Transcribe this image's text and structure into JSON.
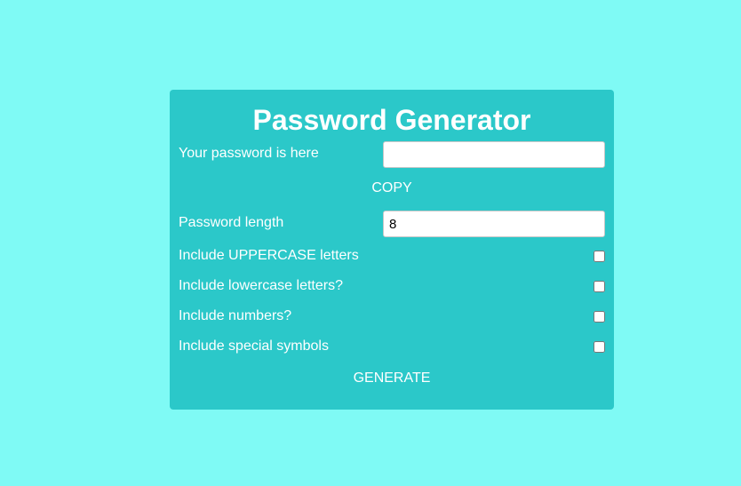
{
  "app": {
    "title": "Password Generator"
  },
  "password": {
    "label": "Your password is here",
    "value": "",
    "placeholder": ""
  },
  "copy_label": "COPY",
  "length": {
    "label": "Password length",
    "value": "8"
  },
  "options": [
    {
      "label": "Include UPPERCASE letters",
      "checked": false
    },
    {
      "label": "Include lowercase letters?",
      "checked": false
    },
    {
      "label": "Include numbers?",
      "checked": false
    },
    {
      "label": "Include special symbols",
      "checked": false
    }
  ],
  "generate_label": "GENERATE",
  "colors": {
    "page_background": "#7ffaf5",
    "card_background": "#2bc8c9",
    "text": "#ffffff"
  }
}
